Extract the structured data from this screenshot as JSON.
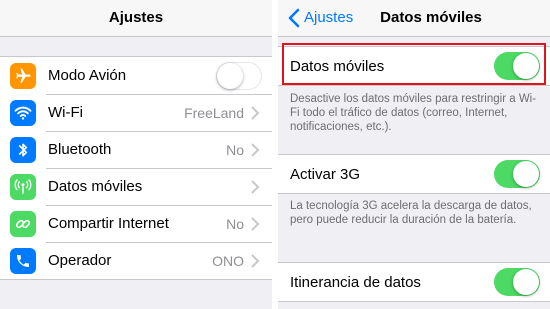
{
  "left": {
    "title": "Ajustes",
    "items": [
      {
        "label": "Modo Avión",
        "value": "",
        "icon": "airplane-icon",
        "color": "#ff9500",
        "control": "toggle-off"
      },
      {
        "label": "Wi-Fi",
        "value": "FreeLand",
        "icon": "wifi-icon",
        "color": "#007aff",
        "control": "chevron"
      },
      {
        "label": "Bluetooth",
        "value": "No",
        "icon": "bluetooth-icon",
        "color": "#007aff",
        "control": "chevron"
      },
      {
        "label": "Datos móviles",
        "value": "",
        "icon": "antenna-icon",
        "color": "#4cd964",
        "control": "chevron"
      },
      {
        "label": "Compartir Internet",
        "value": "No",
        "icon": "link-icon",
        "color": "#4cd964",
        "control": "chevron"
      },
      {
        "label": "Operador",
        "value": "ONO",
        "icon": "phone-icon",
        "color": "#007aff",
        "control": "chevron"
      }
    ]
  },
  "right": {
    "back_label": "Ajustes",
    "title": "Datos móviles",
    "sections": [
      {
        "label": "Datos móviles",
        "toggle": "on",
        "note": "Desactive los datos móviles para restringir a Wi-Fi todo el tráfico de datos (correo, Internet, notificaciones, etc.)."
      },
      {
        "label": "Activar 3G",
        "toggle": "on",
        "note": "La tecnología 3G acelera la descarga de datos, pero puede reducir la duración de la batería."
      },
      {
        "label": "Itinerancia de datos",
        "toggle": "on",
        "note": ""
      }
    ]
  },
  "colors": {
    "accent": "#007aff",
    "toggle_on": "#4cd964",
    "highlight": "#e1141b",
    "background": "#efeff4"
  }
}
